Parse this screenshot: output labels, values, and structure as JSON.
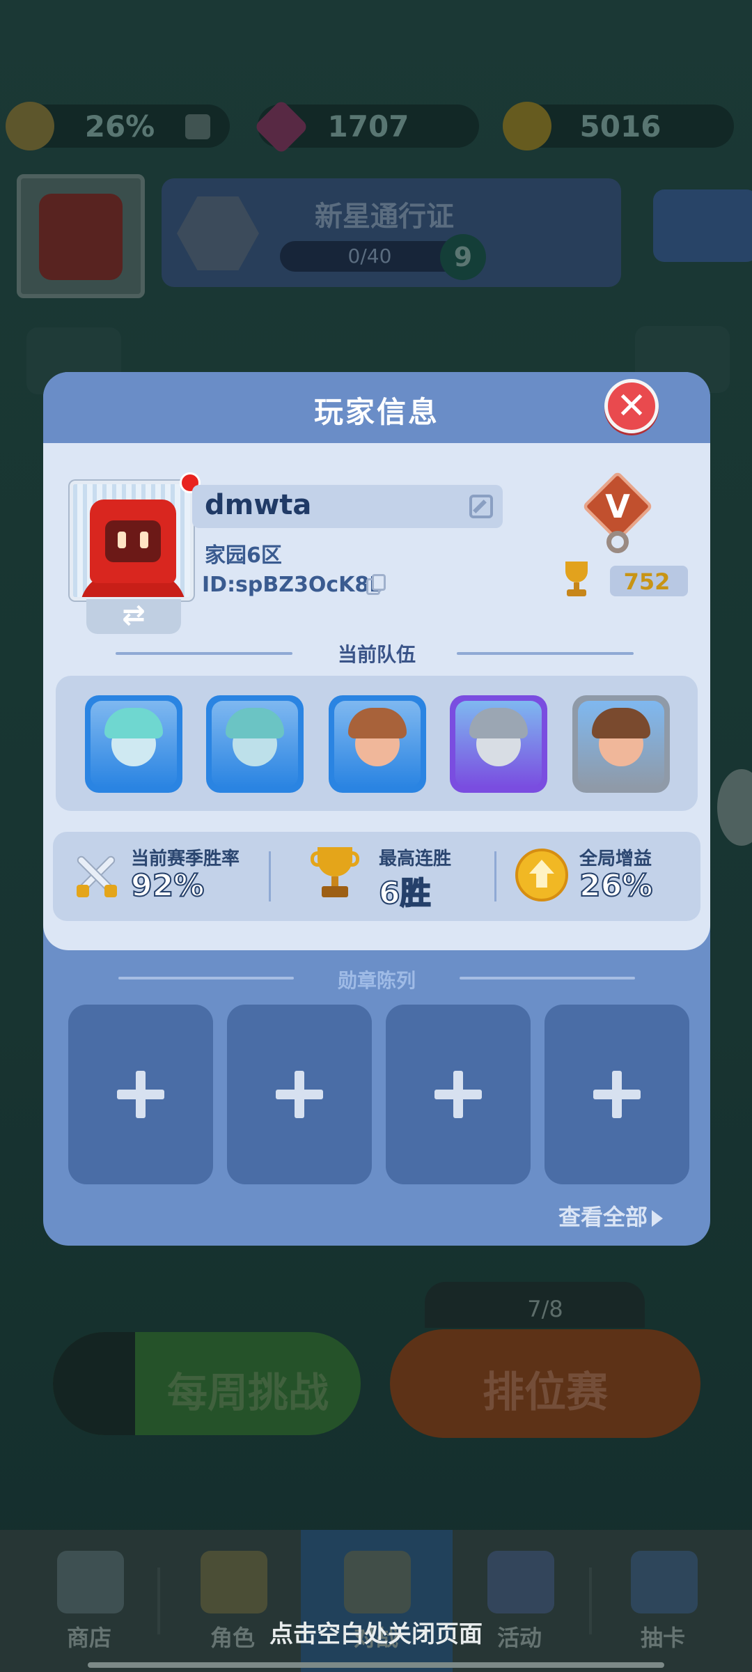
{
  "resources": {
    "boost": "26%",
    "gems": "1707",
    "coins": "5016"
  },
  "pass": {
    "title": "新星通行证",
    "progress": "0/40",
    "level": "9"
  },
  "bottom_buttons": {
    "weekly": "每周挑战",
    "ranked": "排位赛",
    "ranked_counter": "7/8"
  },
  "nav": {
    "items": [
      "商店",
      "角色",
      "对战",
      "活动",
      "抽卡"
    ]
  },
  "modal": {
    "title": "玩家信息",
    "player": {
      "name": "dmwta",
      "home": "家园6区",
      "id": "ID:spBZ3OcK8B",
      "trophies": "752",
      "rank_letter": "V"
    },
    "team_section_title": "当前队伍",
    "team": [
      {
        "name": "hero-teal-goggles",
        "frame": "#2a84e2",
        "skin": "#cfe9f2",
        "hair": "#6fd7d0"
      },
      {
        "name": "hero-purple-horns",
        "frame": "#2a84e2",
        "skin": "#bde0ea",
        "hair": "#6bc4c4"
      },
      {
        "name": "hero-brown-hood",
        "frame": "#2a84e2",
        "skin": "#f0b79a",
        "hair": "#a8623a"
      },
      {
        "name": "hero-knight",
        "frame": "#7a4de0",
        "skin": "#d8dde4",
        "hair": "#9ba6b3"
      },
      {
        "name": "hero-fur-hat",
        "frame": "#8f9aa8",
        "skin": "#f0b79a",
        "hair": "#7a4a2e"
      }
    ],
    "stats": {
      "winrate_label": "当前赛季胜率",
      "winrate_value": "92%",
      "streak_label": "最高连胜",
      "streak_value": "6胜",
      "boost_label": "全局增益",
      "boost_value": "26%"
    },
    "medal_section_title": "勋章陈列",
    "medal_slots": 4,
    "view_all": "查看全部"
  },
  "tap_close_hint": "点击空白处关闭页面"
}
